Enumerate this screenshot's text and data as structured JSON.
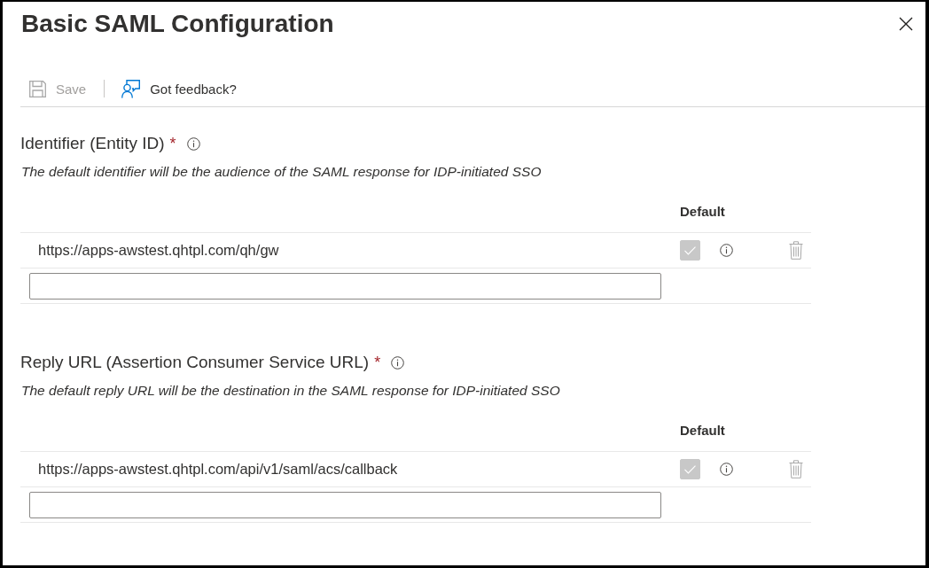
{
  "dialog": {
    "title": "Basic SAML Configuration"
  },
  "toolbar": [
    {
      "kind": "save",
      "label": "Save",
      "disabled": true
    },
    {
      "kind": "feedback",
      "label": "Got feedback?",
      "disabled": false
    }
  ],
  "sections": [
    {
      "heading": "Identifier (Entity ID)",
      "required_mark": "*",
      "description": "The default identifier will be the audience of the SAML response for IDP-initiated SSO",
      "column_header": "Default",
      "rows": [
        {
          "value": "https://apps-awstest.qhtpl.com/qh/gw",
          "checked": true,
          "disabled": true
        }
      ]
    },
    {
      "heading": "Reply URL (Assertion Consumer Service URL)",
      "required_mark": "*",
      "description": "The default reply URL will be the destination in the SAML response for IDP-initiated SSO",
      "column_header": "Default",
      "rows": [
        {
          "value": "https://apps-awstest.qhtpl.com/api/v1/saml/acs/callback",
          "checked": true,
          "disabled": true
        }
      ]
    }
  ]
}
